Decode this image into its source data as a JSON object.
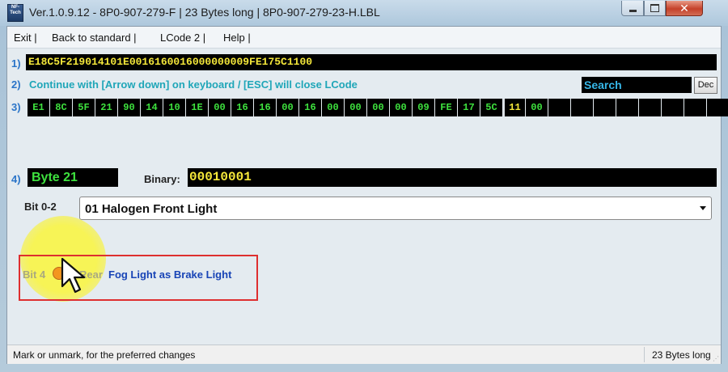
{
  "window": {
    "title": "Ver.1.0.9.12 -   8P0-907-279-F | 23 Bytes long | 8P0-907-279-23-H.LBL",
    "logo_text": "NF-Tech",
    "close_glyph": "✕"
  },
  "menu": {
    "items": [
      {
        "label": "Exit |"
      },
      {
        "label": "Back to standard |"
      },
      {
        "label": "LCode 2 |"
      },
      {
        "label": "Help |"
      }
    ]
  },
  "row1": {
    "number": "1)",
    "value": "E18C5F219014101E0016160016000000009FE175C1100"
  },
  "row2": {
    "number": "2)",
    "hint": "Continue with [Arrow down] on keyboard / [ESC] will close LCode",
    "search_label": "Search",
    "dec_label": "Dec"
  },
  "row3": {
    "number": "3)",
    "bytes": [
      "E1",
      "8C",
      "5F",
      "21",
      "90",
      "14",
      "10",
      "1E",
      "00",
      "16",
      "16",
      "00",
      "16",
      "00",
      "00",
      "00",
      "00",
      "09",
      "FE",
      "17",
      "5C",
      "11",
      "00",
      "",
      "",
      "",
      "",
      "",
      "",
      "",
      ""
    ],
    "selected_index": 21
  },
  "row4": {
    "number": "4)",
    "byte_name": "Byte 21",
    "binary_label": "Binary:",
    "binary_value": "00010001"
  },
  "bit_0_2": {
    "label": "Bit 0-2",
    "selected": "01 Halogen Front Light"
  },
  "bit_4": {
    "label": "Bit 4",
    "text_hidden": "Rear",
    "text_visible": "Fog Light as Brake Light"
  },
  "status": {
    "left": "Mark or unmark, for the preferred changes",
    "right": "23 Bytes long"
  },
  "colors": {
    "hex_yellow": "#f4e73a",
    "byte_green": "#3ee23e",
    "highlight_red": "#de2f2f",
    "cursor_halo": "#f8f44e"
  }
}
